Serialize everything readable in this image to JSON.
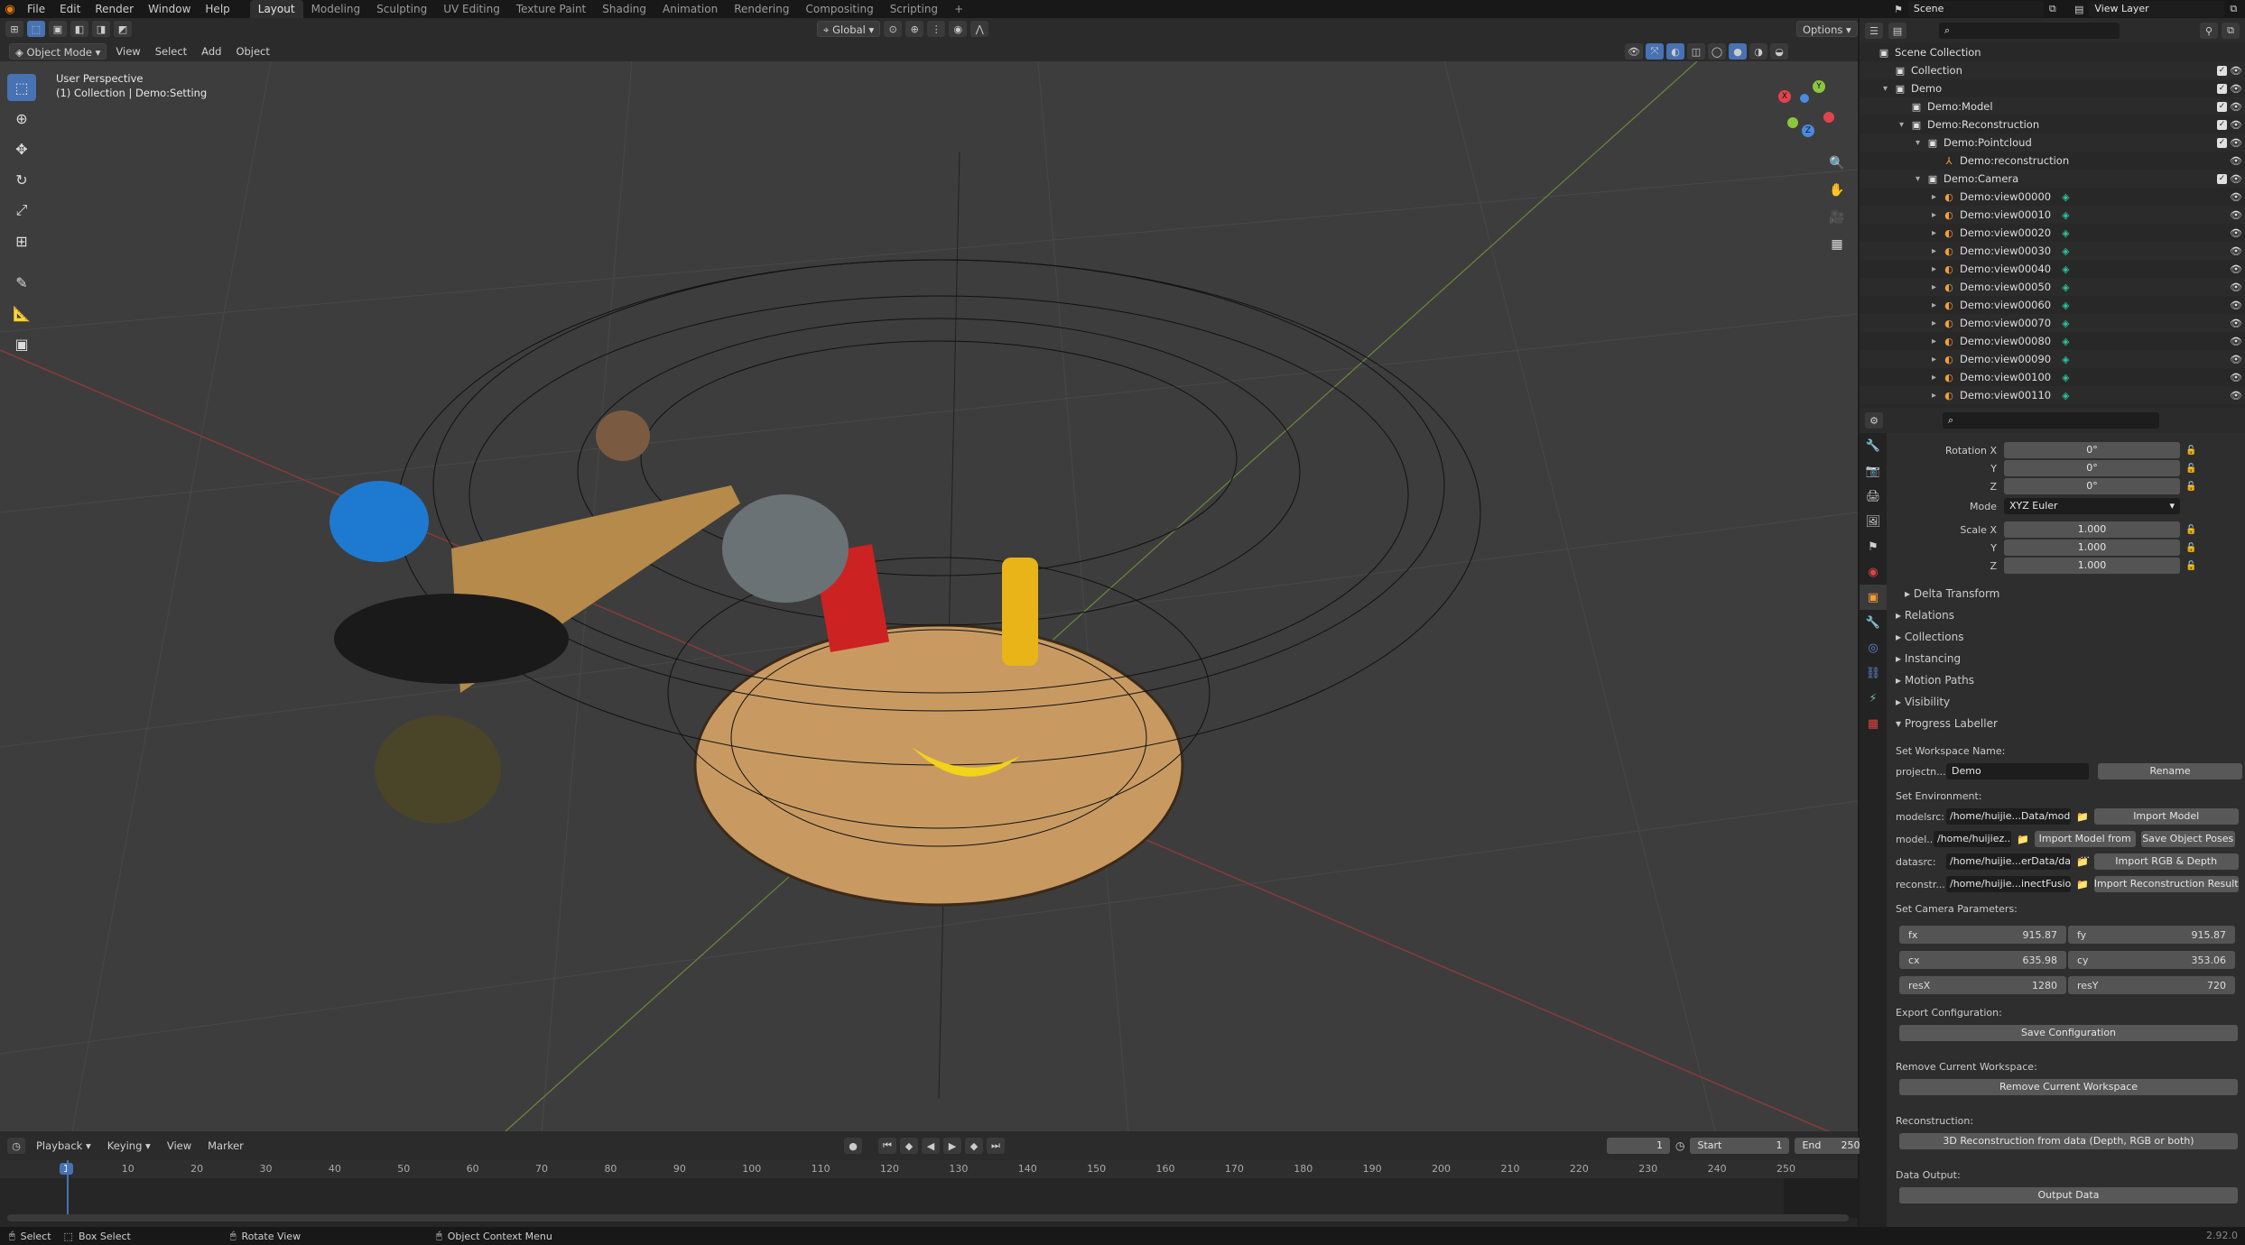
{
  "app": {
    "version": "2.92.0"
  },
  "topbar": {
    "menus": [
      "File",
      "Edit",
      "Render",
      "Window",
      "Help"
    ],
    "workspaces": [
      "Layout",
      "Modeling",
      "Sculpting",
      "UV Editing",
      "Texture Paint",
      "Shading",
      "Animation",
      "Rendering",
      "Compositing",
      "Scripting",
      "+"
    ],
    "scene": "Scene",
    "view_layer": "View Layer"
  },
  "viewport_header": {
    "mode": "Object Mode",
    "menus": [
      "View",
      "Select",
      "Add",
      "Object"
    ],
    "orientation": "Global",
    "options": "Options"
  },
  "viewport": {
    "perspective": "User Perspective",
    "collection": "(1) Collection | Demo:Setting",
    "axis_labels": [
      "X",
      "Y",
      "Z"
    ]
  },
  "timeline": {
    "menus": [
      "Playback",
      "Keying",
      "View",
      "Marker"
    ],
    "current_frame": "1",
    "start_label": "Start",
    "start": "1",
    "end_label": "End",
    "end": "250",
    "ticks": [
      "1",
      "10",
      "20",
      "30",
      "40",
      "50",
      "60",
      "70",
      "80",
      "90",
      "100",
      "110",
      "120",
      "130",
      "140",
      "150",
      "160",
      "170",
      "180",
      "190",
      "200",
      "210",
      "220",
      "230",
      "240",
      "250"
    ]
  },
  "statusbar": {
    "items": [
      "Select",
      "Box Select",
      "Rotate View",
      "Object Context Menu"
    ],
    "version": "2.92.0"
  },
  "outliner": {
    "rows": [
      {
        "label": "Scene Collection",
        "indent": 0,
        "icon": "collection-icon",
        "check": false
      },
      {
        "label": "Collection",
        "indent": 1,
        "icon": "collection-icon",
        "check": true
      },
      {
        "label": "Demo",
        "indent": 1,
        "icon": "collection-icon",
        "check": true,
        "expand": "▾"
      },
      {
        "label": "Demo:Model",
        "indent": 2,
        "icon": "collection-icon",
        "check": true
      },
      {
        "label": "Demo:Reconstruction",
        "indent": 2,
        "icon": "collection-icon",
        "check": true,
        "expand": "▾"
      },
      {
        "label": "Demo:Pointcloud",
        "indent": 3,
        "icon": "collection-icon",
        "check": true,
        "expand": "▾"
      },
      {
        "label": "Demo:reconstruction",
        "indent": 4,
        "icon": "object-icon",
        "check": false
      },
      {
        "label": "Demo:Camera",
        "indent": 3,
        "icon": "collection-icon",
        "check": true,
        "expand": "▾"
      },
      {
        "label": "Demo:view00000",
        "indent": 4,
        "icon": "camera-icon",
        "check": false,
        "expand": "▸"
      },
      {
        "label": "Demo:view00010",
        "indent": 4,
        "icon": "camera-icon",
        "check": false,
        "expand": "▸"
      },
      {
        "label": "Demo:view00020",
        "indent": 4,
        "icon": "camera-icon",
        "check": false,
        "expand": "▸"
      },
      {
        "label": "Demo:view00030",
        "indent": 4,
        "icon": "camera-icon",
        "check": false,
        "expand": "▸"
      },
      {
        "label": "Demo:view00040",
        "indent": 4,
        "icon": "camera-icon",
        "check": false,
        "expand": "▸"
      },
      {
        "label": "Demo:view00050",
        "indent": 4,
        "icon": "camera-icon",
        "check": false,
        "expand": "▸"
      },
      {
        "label": "Demo:view00060",
        "indent": 4,
        "icon": "camera-icon",
        "check": false,
        "expand": "▸"
      },
      {
        "label": "Demo:view00070",
        "indent": 4,
        "icon": "camera-icon",
        "check": false,
        "expand": "▸"
      },
      {
        "label": "Demo:view00080",
        "indent": 4,
        "icon": "camera-icon",
        "check": false,
        "expand": "▸"
      },
      {
        "label": "Demo:view00090",
        "indent": 4,
        "icon": "camera-icon",
        "check": false,
        "expand": "▸"
      },
      {
        "label": "Demo:view00100",
        "indent": 4,
        "icon": "camera-icon",
        "check": false,
        "expand": "▸"
      },
      {
        "label": "Demo:view00110",
        "indent": 4,
        "icon": "camera-icon",
        "check": false,
        "expand": "▸"
      }
    ]
  },
  "properties": {
    "transform": {
      "rotation_label": "Rotation X",
      "rx": "0°",
      "ry": "0°",
      "rz": "0°",
      "y_label": "Y",
      "z_label": "Z",
      "mode_label": "Mode",
      "mode": "XYZ Euler",
      "scale_label": "Scale X",
      "sx": "1.000",
      "sy": "1.000",
      "sz": "1.000",
      "delta": "Delta Transform"
    },
    "panels": [
      "Relations",
      "Collections",
      "Instancing",
      "Motion Paths",
      "Visibility"
    ],
    "labeller": {
      "title": "Progress Labeller",
      "workspace_name_label": "Set Workspace Name:",
      "project_label": "projectn...",
      "project_value": "Demo",
      "rename": "Rename",
      "environment_label": "Set Environment:",
      "modelsrc_label": "modelsrc:",
      "modelsrc": "/home/huijie...Data/model/",
      "import_model": "Import Model",
      "model_label": "model...",
      "model": "/home/huijiez...",
      "import_model_from": "Import Model from ...",
      "save_object_poses": "Save Object Poses",
      "datasrc_label": "datasrc:",
      "datasrc": "/home/huijie...erData/data/",
      "import_rgb": "Import RGB & Depth",
      "reconstr_label": "reconstr...",
      "reconstr": "/home/huijie...inectFusion/",
      "import_recon": "Import Reconstruction Result",
      "camera_label": "Set Camera Parameters:",
      "fx_label": "fx",
      "fx": "915.87",
      "fy_label": "fy",
      "fy": "915.87",
      "cx_label": "cx",
      "cx": "635.98",
      "cy_label": "cy",
      "cy": "353.06",
      "resx_label": "resX",
      "resx": "1280",
      "resy_label": "resY",
      "resy": "720",
      "export_label": "Export Configuration:",
      "save_config": "Save Configuration",
      "remove_label": "Remove Current Workspace:",
      "remove_btn": "Remove Current Workspace",
      "recon_label": "Reconstruction:",
      "recon_btn": "3D Reconstruction from data (Depth, RGB or both)",
      "output_label": "Data Output:",
      "output_btn": "Output Data"
    }
  }
}
